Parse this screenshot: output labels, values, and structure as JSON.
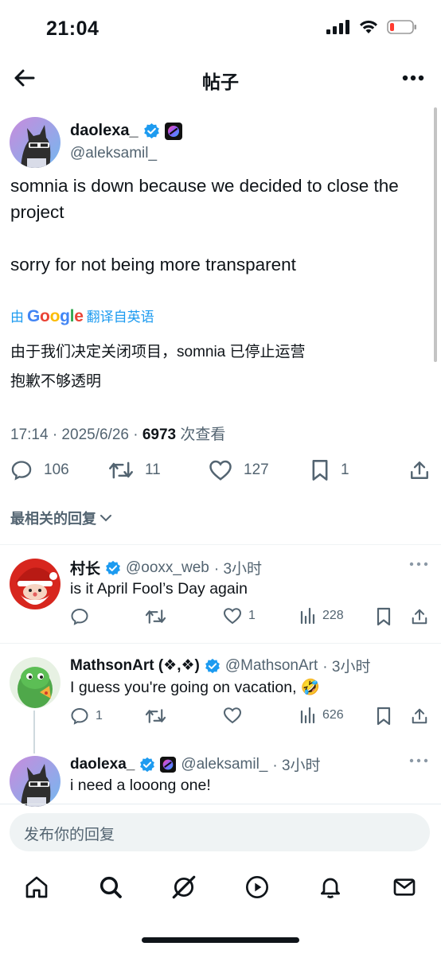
{
  "status": {
    "time": "21:04"
  },
  "header": {
    "title": "帖子"
  },
  "post": {
    "author_name": "daolexa_",
    "author_handle": "@aleksamil_",
    "text_line1": "somnia is down because we decided to close the",
    "text_line2": "project",
    "text_line3": "sorry for not being more transparent",
    "translate_prefix": "由",
    "translate_brand": "Google",
    "translate_suffix": "翻译自英语",
    "translation_line1": "由于我们决定关闭项目，somnia 已停止运营",
    "translation_line2": "抱歉不够透明",
    "timestamp": "17:14 · 2025/6/26 · ",
    "views": "6973",
    "views_label": " 次查看",
    "replies": "106",
    "reposts": "11",
    "likes": "127",
    "bookmarks": "1"
  },
  "sort_label": "最相关的回复",
  "replies": [
    {
      "name": "村长",
      "handle": "@ooxx_web",
      "time": "· 3小时",
      "text": "is it April Fool’s Day again",
      "replies": "",
      "reposts": "",
      "likes": "1",
      "views": "228"
    },
    {
      "name": "MathsonArt (❖,❖)",
      "handle": "@MathsonArt",
      "time": "· 3小时",
      "text": "I guess you're going on vacation, ",
      "emoji": "🤣",
      "replies": "1",
      "reposts": "",
      "likes": "",
      "views": "626"
    },
    {
      "name": "daolexa_",
      "handle": "@aleksamil_",
      "time": "· 3小时",
      "text": "i need a looong one!"
    }
  ],
  "composer": {
    "placeholder": "发布你的回复"
  },
  "colors": {
    "accent": "#1d9bf0",
    "text": "#0f1419",
    "muted": "#536471"
  },
  "tabs": [
    "home-icon",
    "search-icon",
    "grok-icon",
    "video-icon",
    "notifications-icon",
    "messages-icon"
  ]
}
